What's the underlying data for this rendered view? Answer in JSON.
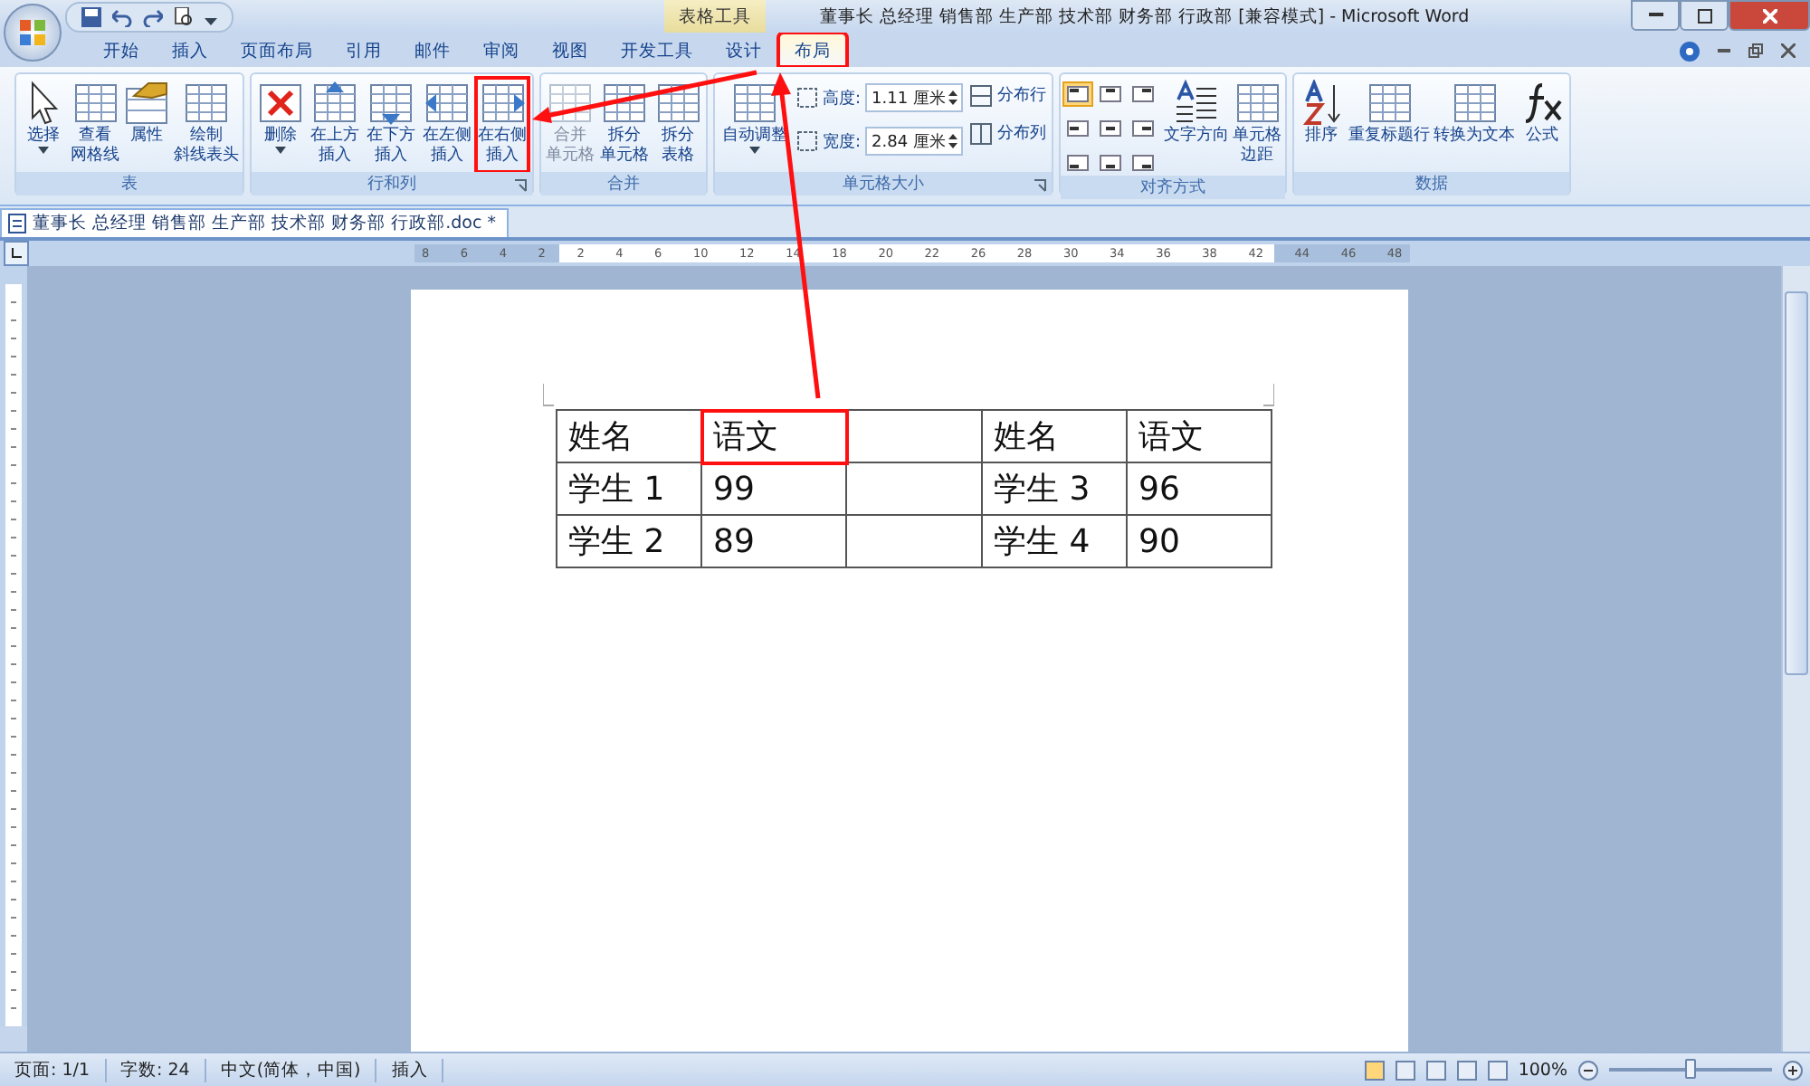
{
  "window": {
    "context_label": "表格工具",
    "title": "董事长 总经理 销售部 生产部 技术部 财务部 行政部 [兼容模式] - Microsoft Word"
  },
  "tabs": [
    {
      "label": "开始",
      "selected": false,
      "highlighted": false
    },
    {
      "label": "插入",
      "selected": false,
      "highlighted": false
    },
    {
      "label": "页面布局",
      "selected": false,
      "highlighted": false
    },
    {
      "label": "引用",
      "selected": false,
      "highlighted": false
    },
    {
      "label": "邮件",
      "selected": false,
      "highlighted": false
    },
    {
      "label": "审阅",
      "selected": false,
      "highlighted": false
    },
    {
      "label": "视图",
      "selected": false,
      "highlighted": false
    },
    {
      "label": "开发工具",
      "selected": false,
      "highlighted": false
    },
    {
      "label": "设计",
      "selected": false,
      "highlighted": false
    },
    {
      "label": "布局",
      "selected": true,
      "highlighted": true
    }
  ],
  "ribbon": {
    "groups": [
      {
        "label": "表",
        "buttons": [
          {
            "lines": [
              "选择"
            ],
            "menu": true,
            "disabled": false,
            "highlighted": false
          },
          {
            "lines": [
              "查看",
              "网格线"
            ],
            "disabled": false,
            "highlighted": false
          },
          {
            "lines": [
              "属性"
            ],
            "disabled": false,
            "highlighted": false
          },
          {
            "lines": [
              "绘制",
              "斜线表头"
            ],
            "disabled": false,
            "highlighted": false
          }
        ]
      },
      {
        "label": "行和列",
        "launcher": true,
        "buttons": [
          {
            "lines": [
              "删除"
            ],
            "menu": true,
            "disabled": false,
            "highlighted": false
          },
          {
            "lines": [
              "在上方",
              "插入"
            ],
            "disabled": false,
            "highlighted": false
          },
          {
            "lines": [
              "在下方",
              "插入"
            ],
            "disabled": false,
            "highlighted": false
          },
          {
            "lines": [
              "在左侧",
              "插入"
            ],
            "disabled": false,
            "highlighted": false
          },
          {
            "lines": [
              "在右侧",
              "插入"
            ],
            "disabled": false,
            "highlighted": true
          }
        ]
      },
      {
        "label": "合并",
        "buttons": [
          {
            "lines": [
              "合并",
              "单元格"
            ],
            "disabled": true,
            "highlighted": false
          },
          {
            "lines": [
              "拆分",
              "单元格"
            ],
            "disabled": false,
            "highlighted": false
          },
          {
            "lines": [
              "拆分",
              "表格"
            ],
            "disabled": false,
            "highlighted": false
          }
        ]
      },
      {
        "label": "单元格大小",
        "launcher": true,
        "buttons": [
          {
            "lines": [
              "自动调整"
            ],
            "menu": true,
            "disabled": false,
            "highlighted": false
          }
        ],
        "fields": [
          {
            "label": "高度:",
            "value": "1.11 厘米"
          },
          {
            "label": "宽度:",
            "value": "2.84 厘米"
          }
        ],
        "small_buttons": [
          {
            "label": "分布行"
          },
          {
            "label": "分布列"
          }
        ]
      },
      {
        "label": "对齐方式",
        "align_buttons": [
          {
            "selected": true
          },
          {
            "selected": false
          },
          {
            "selected": false
          },
          {
            "selected": false
          },
          {
            "selected": false
          },
          {
            "selected": false
          },
          {
            "selected": false
          },
          {
            "selected": false
          },
          {
            "selected": false
          }
        ],
        "buttons": [
          {
            "lines": [
              "文字方向"
            ],
            "disabled": false,
            "highlighted": false
          },
          {
            "lines": [
              "单元格",
              "边距"
            ],
            "disabled": false,
            "highlighted": false
          }
        ]
      },
      {
        "label": "数据",
        "buttons": [
          {
            "lines": [
              "排序"
            ],
            "disabled": false,
            "highlighted": false
          },
          {
            "lines": [
              "重复标题行"
            ],
            "disabled": false,
            "highlighted": false
          },
          {
            "lines": [
              "转换为文本"
            ],
            "disabled": false,
            "highlighted": false
          },
          {
            "lines": [
              "公式"
            ],
            "disabled": false,
            "highlighted": false
          }
        ]
      }
    ]
  },
  "document_tab": {
    "label": "董事长 总经理 销售部 生产部 技术部 财务部 行政部.doc *"
  },
  "ruler": {
    "labels": [
      "8",
      "6",
      "4",
      "2",
      "2",
      "4",
      "6",
      "10",
      "12",
      "14",
      "18",
      "20",
      "22",
      "26",
      "28",
      "30",
      "34",
      "36",
      "38",
      "42",
      "44",
      "46",
      "48"
    ]
  },
  "table": {
    "rows": [
      [
        {
          "text": "姓名",
          "highlighted": false
        },
        {
          "text": "语文",
          "highlighted": true
        },
        {
          "text": "",
          "highlighted": false
        },
        {
          "text": "姓名",
          "highlighted": false
        },
        {
          "text": "语文",
          "highlighted": false
        }
      ],
      [
        {
          "text": "学生 1",
          "highlighted": false
        },
        {
          "text": "99",
          "highlighted": false
        },
        {
          "text": "",
          "highlighted": false
        },
        {
          "text": "学生 3",
          "highlighted": false
        },
        {
          "text": "96",
          "highlighted": false
        }
      ],
      [
        {
          "text": "学生 2",
          "highlighted": false
        },
        {
          "text": "89",
          "highlighted": false
        },
        {
          "text": "",
          "highlighted": false
        },
        {
          "text": "学生 4",
          "highlighted": false
        },
        {
          "text": "90",
          "highlighted": false
        }
      ]
    ]
  },
  "status_bar": {
    "items": [
      "页面: 1/1",
      "字数: 24",
      "中文(简体，中国)",
      "插入"
    ],
    "zoom": "100%",
    "zoom_slider": {
      "level": 0.5
    }
  }
}
